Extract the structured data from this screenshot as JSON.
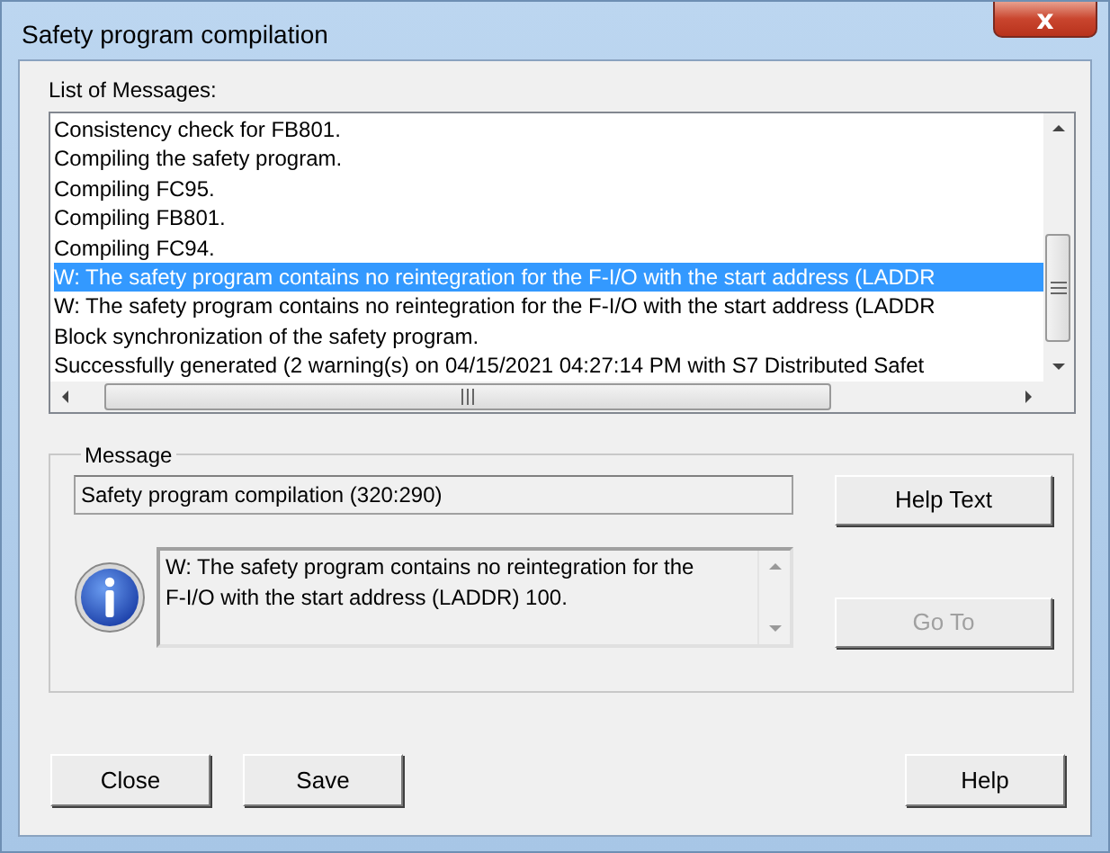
{
  "window": {
    "title": "Safety program compilation",
    "close_glyph": "x"
  },
  "list": {
    "label": "List of Messages:",
    "items": [
      {
        "text": "Consistency check for FB801.",
        "selected": false
      },
      {
        "text": "Compiling the safety program.",
        "selected": false
      },
      {
        "text": "Compiling FC95.",
        "selected": false
      },
      {
        "text": "Compiling FB801.",
        "selected": false
      },
      {
        "text": "Compiling FC94.",
        "selected": false
      },
      {
        "text": "W: The safety program contains no reintegration for the F-I/O with the start address (LADDR",
        "selected": true
      },
      {
        "text": "W: The safety program contains no reintegration for the F-I/O with the start address (LADDR",
        "selected": false
      },
      {
        "text": "Block synchronization of the safety program.",
        "selected": false
      },
      {
        "text": "Successfully generated (2 warning(s) on 04/15/2021 04:27:14 PM with S7 Distributed Safet",
        "selected": false
      }
    ]
  },
  "message": {
    "legend": "Message",
    "source": "Safety program compilation (320:290)",
    "text": "W: The safety program contains no reintegration for the F-I/O with the start address (LADDR) 100.",
    "buttons": [
      {
        "label": "Help Text",
        "disabled": false
      },
      {
        "label": "Go To",
        "disabled": true
      }
    ]
  },
  "buttons": [
    "Close",
    "Save",
    "Help"
  ]
}
